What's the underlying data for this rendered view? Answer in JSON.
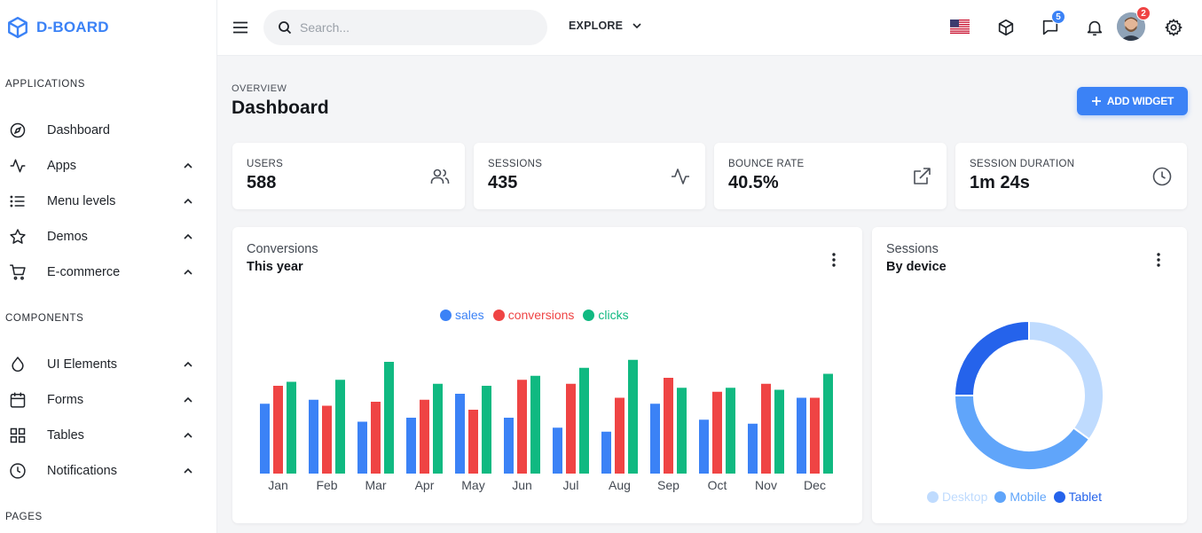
{
  "brand": {
    "name": "D-BOARD",
    "color": "#3b82f6"
  },
  "sidebar": {
    "sections": [
      {
        "label": "APPLICATIONS"
      },
      {
        "label": "COMPONENTS"
      },
      {
        "label": "PAGES"
      }
    ],
    "items": [
      {
        "label": "Dashboard",
        "icon": "compass-icon"
      },
      {
        "label": "Apps",
        "icon": "activity-icon"
      },
      {
        "label": "Menu levels",
        "icon": "list-icon"
      },
      {
        "label": "Demos",
        "icon": "star-icon"
      },
      {
        "label": "E-commerce",
        "icon": "cart-icon"
      },
      {
        "label": "UI Elements",
        "icon": "droplet-icon"
      },
      {
        "label": "Forms",
        "icon": "calendar-icon"
      },
      {
        "label": "Tables",
        "icon": "grid-icon"
      },
      {
        "label": "Notifications",
        "icon": "clock-icon"
      }
    ]
  },
  "topbar": {
    "search_placeholder": "Search...",
    "explore_label": "EXPLORE",
    "messages_badge": "5",
    "avatar_badge": "2",
    "badge_colors": {
      "messages": "#3b82f6",
      "avatar": "#ef4444"
    }
  },
  "header": {
    "overline": "OVERVIEW",
    "title": "Dashboard",
    "add_widget_label": "ADD WIDGET"
  },
  "stats": [
    {
      "label": "USERS",
      "value": "588",
      "icon": "users-icon"
    },
    {
      "label": "SESSIONS",
      "value": "435",
      "icon": "activity-icon"
    },
    {
      "label": "BOUNCE RATE",
      "value": "40.5%",
      "icon": "external-link-icon"
    },
    {
      "label": "SESSION DURATION",
      "value": "1m 24s",
      "icon": "clock-icon"
    }
  ],
  "conversions": {
    "title": "Conversions",
    "subtitle": "This year",
    "chart_data": {
      "type": "bar",
      "categories": [
        "Jan",
        "Feb",
        "Mar",
        "Apr",
        "May",
        "Jun",
        "Jul",
        "Aug",
        "Sep",
        "Oct",
        "Nov",
        "Dec"
      ],
      "series": [
        {
          "name": "sales",
          "color": "#3b82f6",
          "values": [
            35,
            37,
            26,
            28,
            40,
            28,
            23,
            21,
            35,
            27,
            25,
            38
          ]
        },
        {
          "name": "conversions",
          "color": "#ef4444",
          "values": [
            44,
            34,
            36,
            37,
            32,
            47,
            45,
            38,
            48,
            41,
            45,
            38
          ]
        },
        {
          "name": "clicks",
          "color": "#10b981",
          "values": [
            46,
            47,
            56,
            45,
            44,
            49,
            53,
            57,
            43,
            43,
            42,
            50
          ]
        }
      ],
      "ylim": [
        0,
        60
      ],
      "legend": "top-center",
      "grid": false
    }
  },
  "sessions": {
    "title": "Sessions",
    "subtitle": "By device",
    "chart_data": {
      "type": "pie",
      "donut": true,
      "categories": [
        "Desktop",
        "Mobile",
        "Tablet"
      ],
      "values": [
        35,
        40,
        25
      ],
      "colors": [
        "#bfdbfe",
        "#60a5fa",
        "#2563eb"
      ],
      "legend": "bottom-center"
    }
  }
}
